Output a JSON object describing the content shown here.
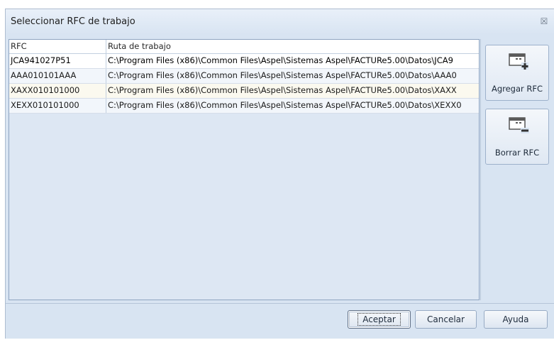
{
  "dialog": {
    "title": "Seleccionar RFC de trabajo",
    "close_glyph": "☒"
  },
  "grid": {
    "columns": [
      "RFC",
      "Ruta de trabajo"
    ],
    "rows": [
      {
        "rfc": "JCA941027P51",
        "ruta": "C:\\Program Files (x86)\\Common Files\\Aspel\\Sistemas Aspel\\FACTURe5.00\\Datos\\JCA9"
      },
      {
        "rfc": "AAA010101AAA",
        "ruta": "C:\\Program Files (x86)\\Common Files\\Aspel\\Sistemas Aspel\\FACTURe5.00\\Datos\\AAA0"
      },
      {
        "rfc": "XAXX010101000",
        "ruta": "C:\\Program Files (x86)\\Common Files\\Aspel\\Sistemas Aspel\\FACTURe5.00\\Datos\\XAXX"
      },
      {
        "rfc": "XEXX010101000",
        "ruta": "C:\\Program Files (x86)\\Common Files\\Aspel\\Sistemas Aspel\\FACTURe5.00\\Datos\\XEXX0"
      }
    ]
  },
  "side_buttons": {
    "add_label": "Agregar RFC",
    "delete_label": "Borrar RFC"
  },
  "footer": {
    "accept": "Aceptar",
    "cancel": "Cancelar",
    "help": "Ayuda"
  },
  "icons": {
    "close": "close-icon",
    "add": "window-add-icon",
    "delete": "window-remove-icon"
  }
}
